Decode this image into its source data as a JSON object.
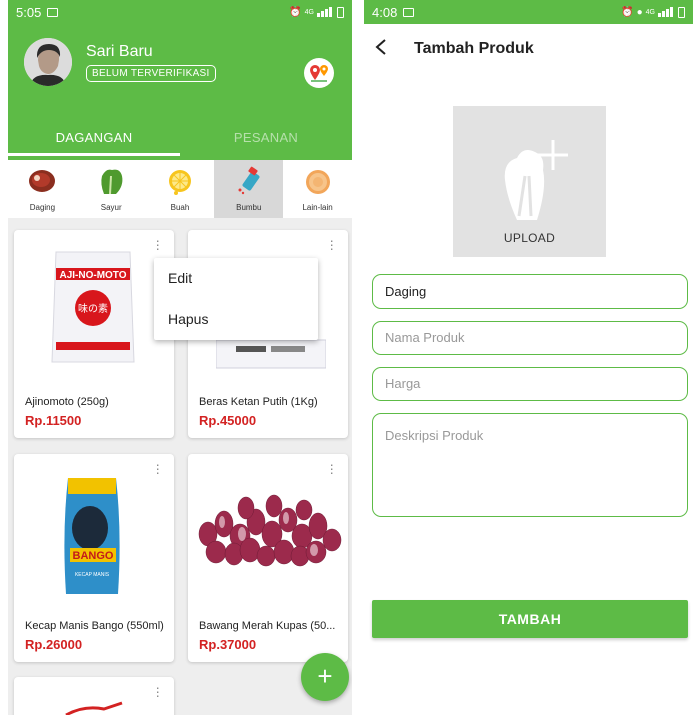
{
  "left": {
    "status": {
      "time": "5:05",
      "icons": [
        "image-icon",
        "alarm-icon",
        "4g-icon",
        "signal-icon",
        "battery-icon"
      ]
    },
    "user": {
      "name": "Sari Baru",
      "badge": "BELUM TERVERIFIKASI"
    },
    "tabs": [
      {
        "label": "DAGANGAN",
        "active": true
      },
      {
        "label": "PESANAN",
        "active": false
      }
    ],
    "categories": [
      {
        "label": "Daging",
        "icon": "meat-icon"
      },
      {
        "label": "Sayur",
        "icon": "vegetable-icon"
      },
      {
        "label": "Buah",
        "icon": "fruit-icon"
      },
      {
        "label": "Bumbu",
        "icon": "spice-icon",
        "active": true
      },
      {
        "label": "Lain-lain",
        "icon": "other-icon"
      }
    ],
    "products": [
      {
        "name": "Ajinomoto (250g)",
        "price": "Rp.11500"
      },
      {
        "name": "Beras Ketan Putih (1Kg)",
        "price": "Rp.45000"
      },
      {
        "name": "Kecap Manis Bango (550ml)",
        "price": "Rp.26000"
      },
      {
        "name": "Bawang Merah Kupas (50...",
        "price": "Rp.37000"
      }
    ],
    "product_image_text": {
      "ajinomoto_brand": "AJI-NO-MOTO",
      "ajinomoto_kanji": "味の素",
      "bango_brand": "BANGO",
      "bango_sub": "KECAP MANIS"
    },
    "menu": {
      "edit": "Edit",
      "delete": "Hapus"
    },
    "fab": "+"
  },
  "right": {
    "status": {
      "time": "4:08"
    },
    "title": "Tambah Produk",
    "upload_label": "UPLOAD",
    "category_value": "Daging",
    "fields": {
      "name_placeholder": "Nama Produk",
      "price_placeholder": "Harga",
      "desc_placeholder": "Deskripsi Produk"
    },
    "submit": "TAMBAH"
  },
  "colors": {
    "primary": "#5dbb46",
    "price": "#d32222",
    "active_category": "#d8d8d8"
  }
}
